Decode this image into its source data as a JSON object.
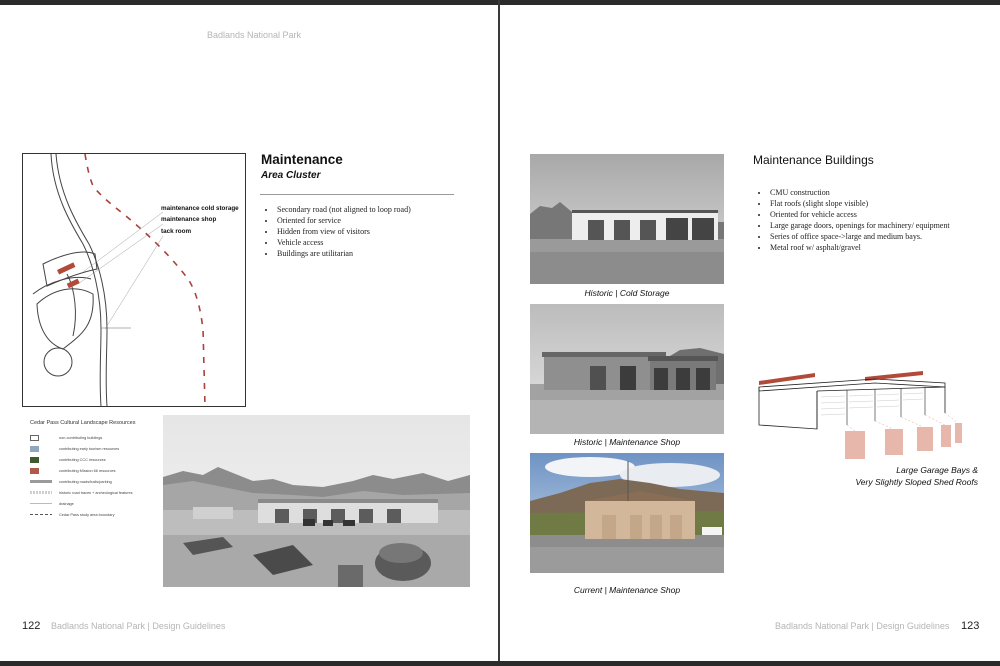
{
  "left_page": {
    "running_header": "Badlands National Park",
    "map_labels": [
      "maintenance cold storage",
      "maintenance shop",
      "tack room"
    ],
    "title": "Maintenance",
    "subtitle": "Area Cluster",
    "bullets": [
      "Secondary road (not aligned to loop road)",
      "Oriented for service",
      "Hidden from view of visitors",
      "Vehicle access",
      "Buildings are utilitarian"
    ],
    "legend": {
      "title": "Cedar Pass Cultural Landscape Resources",
      "items": [
        {
          "label": "non-contributing buildings",
          "color": "#ffffff",
          "style": "box"
        },
        {
          "label": "contributing early tourism resources",
          "color": "#8fa8c0",
          "style": "box"
        },
        {
          "label": "contributing CCC resources",
          "color": "#3f5a2e",
          "style": "box"
        },
        {
          "label": "contributing Mission 66 resources",
          "color": "#b05a4a",
          "style": "box"
        },
        {
          "label": "contributing roads/trails/parking",
          "color": "#9a9a9a",
          "style": "thick"
        },
        {
          "label": "historic road traces + archeological features",
          "color": "#cfcfcf",
          "style": "hatch"
        },
        {
          "label": "drainage",
          "color": "#bbbbbb",
          "style": "thin"
        },
        {
          "label": "Cedar Pass study area boundary",
          "color": "#555555",
          "style": "dash"
        }
      ]
    },
    "page_number": "122",
    "footer": "Badlands National Park | Design Guidelines"
  },
  "right_page": {
    "title": "Maintenance Buildings",
    "bullets": [
      "CMU construction",
      "Flat roofs (slight slope visible)",
      "Oriented for vehicle access",
      "Large garage doors, openings for machinery/ equipment",
      "Series of office space->large and medium bays.",
      "Metal roof w/ asphalt/gravel"
    ],
    "captions": [
      "Historic | Cold Storage",
      "Historic | Maintenance Shop",
      "Current | Maintenance Shop"
    ],
    "diagram_caption": [
      "Large Garage Bays &",
      "Very Slightly Sloped Shed Roofs"
    ],
    "footer": "Badlands National Park | Design Guidelines",
    "page_number": "123"
  },
  "colors": {
    "accent_red": "#b24a3a",
    "dark_bar": "#2b2b2b",
    "muted_text": "#b5b5b5"
  }
}
